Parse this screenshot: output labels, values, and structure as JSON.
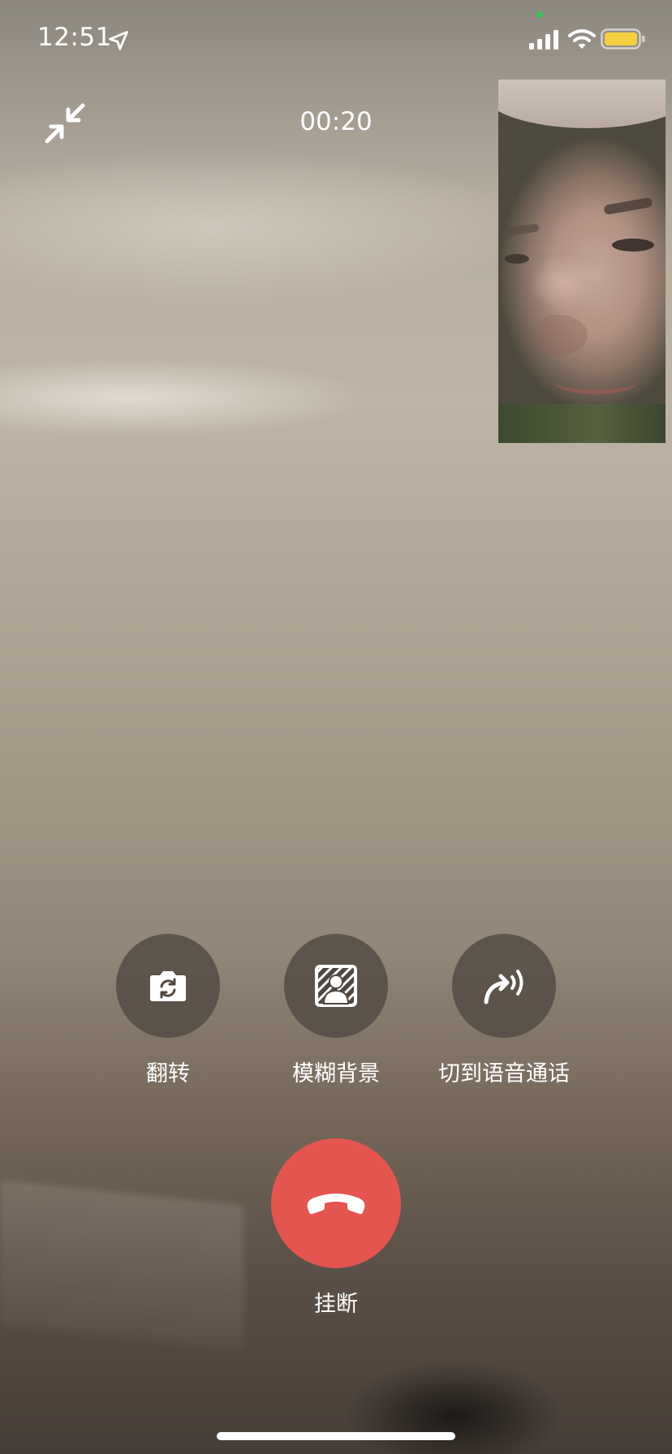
{
  "status_bar": {
    "time": "12:51",
    "location_icon": "location-arrow-icon",
    "signal_icon": "cellular-signal-icon",
    "wifi_icon": "wifi-icon",
    "battery_icon": "battery-icon",
    "privacy_dot_color": "#34c759",
    "battery_color": "#f5d142"
  },
  "call": {
    "minimize_icon": "minimize-arrows-icon",
    "timer": "00:20"
  },
  "actions": [
    {
      "label": "翻转",
      "icon": "camera-flip-icon"
    },
    {
      "label": "模糊背景",
      "icon": "blur-background-icon"
    },
    {
      "label": "切到语音通话",
      "icon": "switch-to-voice-icon"
    }
  ],
  "hangup": {
    "label": "挂断",
    "icon": "phone-hangup-icon",
    "color": "#e45550"
  }
}
